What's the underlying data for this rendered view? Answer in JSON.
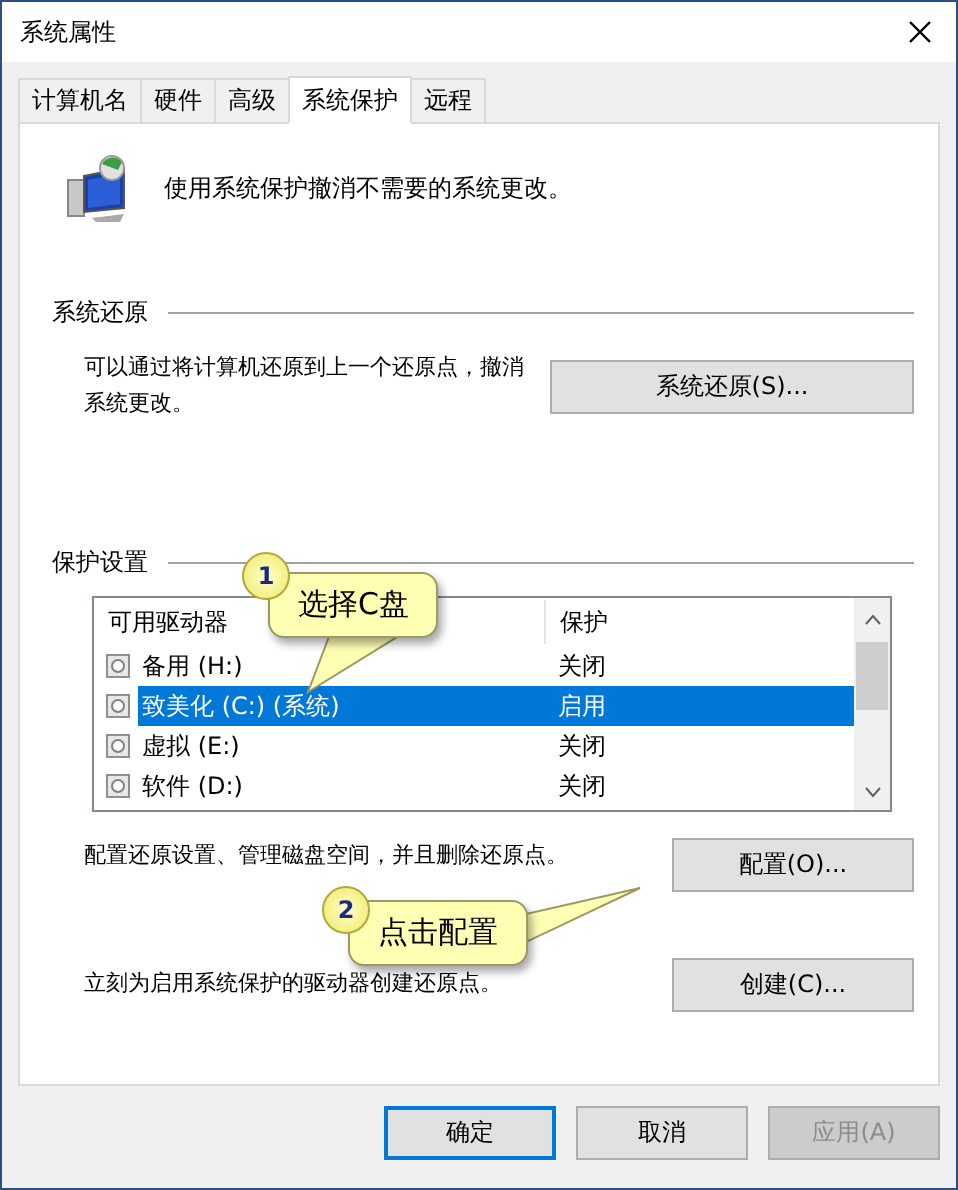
{
  "window": {
    "title": "系统属性"
  },
  "tabs": [
    {
      "label": "计算机名",
      "selected": false
    },
    {
      "label": "硬件",
      "selected": false
    },
    {
      "label": "高级",
      "selected": false
    },
    {
      "label": "系统保护",
      "selected": true
    },
    {
      "label": "远程",
      "selected": false
    }
  ],
  "intro": "使用系统保护撤消不需要的系统更改。",
  "system_restore": {
    "group_label": "系统还原",
    "description": "可以通过将计算机还原到上一个还原点，撤消系统更改。",
    "button": "系统还原(S)..."
  },
  "protection": {
    "group_label": "保护设置",
    "columns": [
      "可用驱动器",
      "保护"
    ],
    "drives": [
      {
        "name": "备用 (H:)",
        "protection": "关闭",
        "selected": false
      },
      {
        "name": "致美化 (C:) (系统)",
        "protection": "启用",
        "selected": true
      },
      {
        "name": "虚拟 (E:)",
        "protection": "关闭",
        "selected": false
      },
      {
        "name": "软件 (D:)",
        "protection": "关闭",
        "selected": false
      }
    ],
    "configure": {
      "description": "配置还原设置、管理磁盘空间，并且删除还原点。",
      "button": "配置(O)..."
    },
    "create": {
      "description": "立刻为启用系统保护的驱动器创建还原点。",
      "button": "创建(C)..."
    }
  },
  "buttons": [
    {
      "label": "确定",
      "default": true,
      "disabled": false
    },
    {
      "label": "取消",
      "default": false,
      "disabled": false
    },
    {
      "label": "应用(A)",
      "default": false,
      "disabled": true
    }
  ],
  "callouts": [
    {
      "number": "1",
      "text": "选择C盘"
    },
    {
      "number": "2",
      "text": "点击配置"
    }
  ]
}
